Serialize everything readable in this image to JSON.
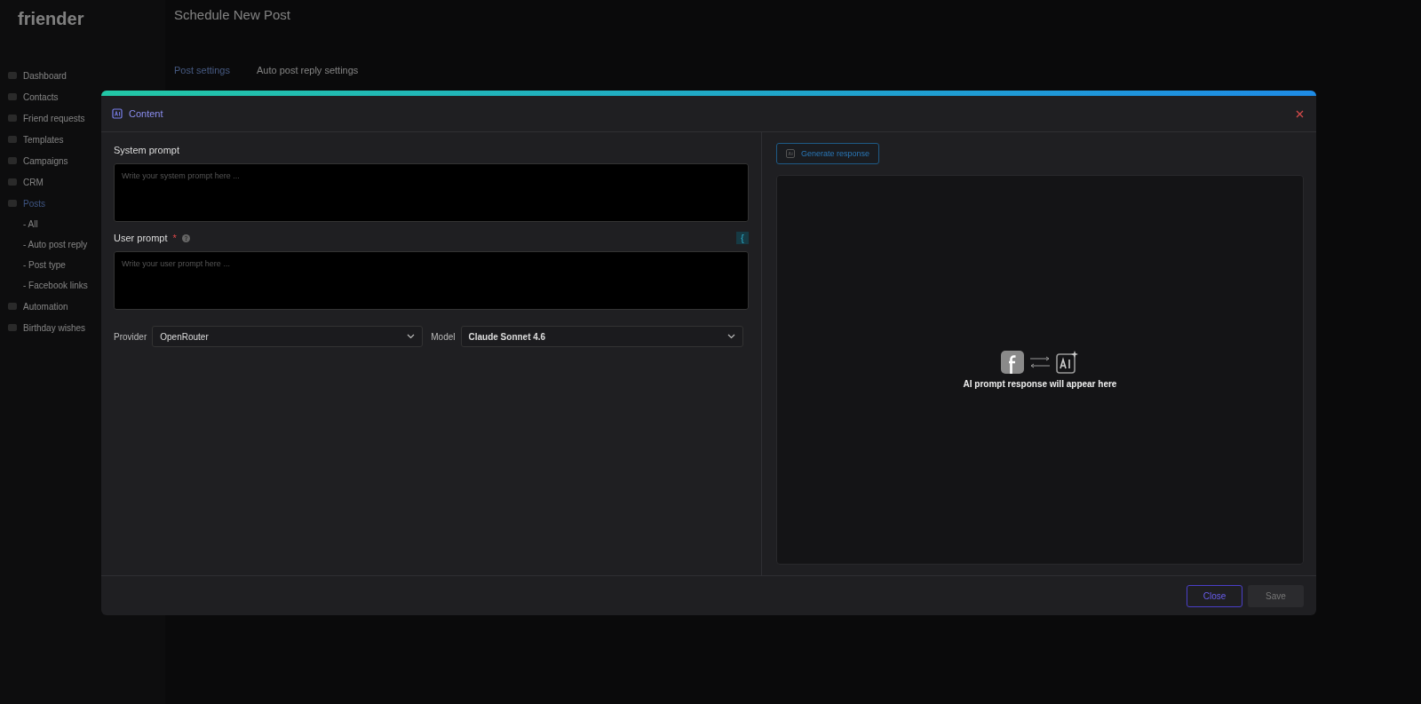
{
  "app": {
    "logo": "friender",
    "sidebar": {
      "items": [
        {
          "label": "Dashboard",
          "selected": false
        },
        {
          "label": "Contacts",
          "selected": false
        },
        {
          "label": "Friend requests",
          "selected": false
        },
        {
          "label": "Templates",
          "selected": false
        },
        {
          "label": "Campaigns",
          "selected": false
        },
        {
          "label": "CRM",
          "selected": false
        },
        {
          "label": "Posts",
          "selected": true,
          "children": [
            {
              "label": "- All",
              "selected": false
            },
            {
              "label": "- Auto post reply",
              "selected": false
            },
            {
              "label": "- Post type",
              "selected": false
            },
            {
              "label": "- Facebook links",
              "selected": false
            }
          ]
        },
        {
          "label": "Automation",
          "selected": false
        },
        {
          "label": "Birthday wishes",
          "selected": false
        }
      ]
    },
    "page": {
      "title": "Schedule New Post",
      "tabs": [
        {
          "label": "Post settings",
          "selected": true
        },
        {
          "label": "Auto post reply settings",
          "selected": false
        }
      ]
    }
  },
  "modal": {
    "title": "Content",
    "system_prompt": {
      "label": "System prompt",
      "placeholder": "Write your system prompt here ..."
    },
    "user_prompt": {
      "label": "User prompt",
      "required_mark": "*",
      "placeholder": "Write your user prompt here ..."
    },
    "variable_button": "{",
    "provider": {
      "label": "Provider",
      "value": "OpenRouter"
    },
    "model": {
      "label": "Model",
      "value": "Claude Sonnet 4.6"
    },
    "generate_button": "Generate response",
    "response_placeholder": "AI prompt response will appear here",
    "buttons": [
      {
        "label": "Close",
        "kind": "outline",
        "disabled": false
      },
      {
        "label": "Save",
        "kind": "filled",
        "disabled": true
      }
    ]
  }
}
